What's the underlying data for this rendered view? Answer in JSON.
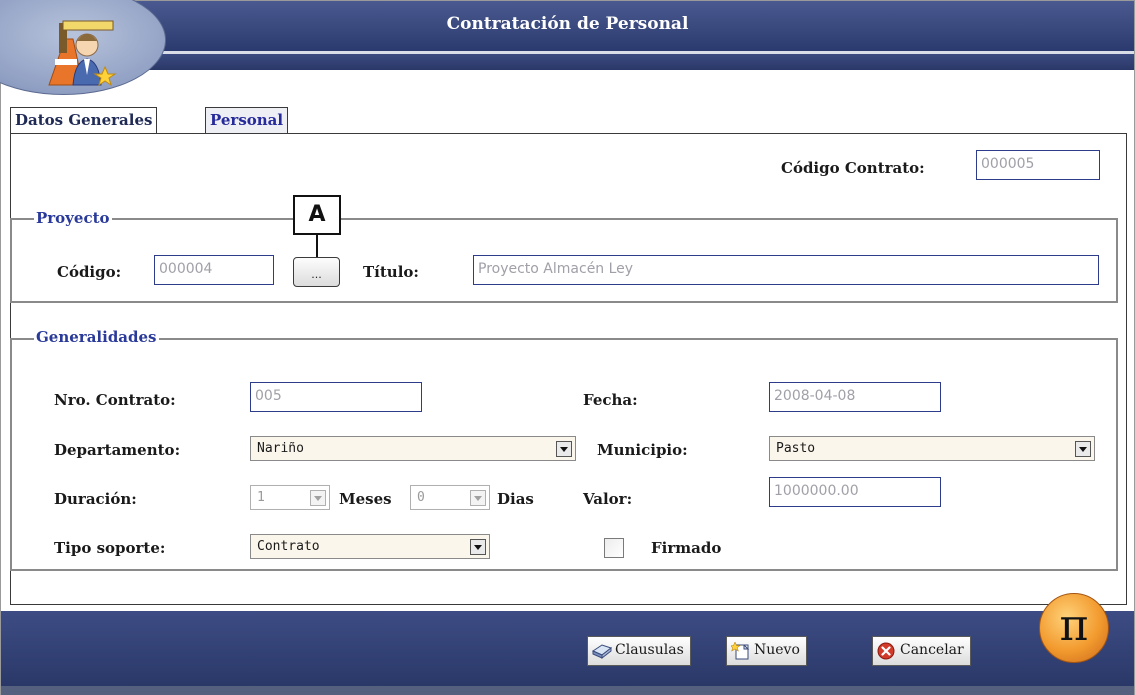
{
  "window": {
    "title": "Contratación de Personal"
  },
  "tabs": [
    {
      "label": "Datos Generales"
    },
    {
      "label": "Personal"
    }
  ],
  "codigo_contrato": {
    "label": "Código Contrato:",
    "value": "000005"
  },
  "proyecto": {
    "legend": "Proyecto",
    "codigo_label": "Código:",
    "codigo_value": "000004",
    "search_button": "...",
    "callout": "A",
    "titulo_label": "Título:",
    "titulo_value": "Proyecto Almacén Ley"
  },
  "generalidades": {
    "legend": "Generalidades",
    "nro_contrato_label": "Nro. Contrato:",
    "nro_contrato_value": "005",
    "fecha_label": "Fecha:",
    "fecha_value": "2008-04-08",
    "departamento_label": "Departamento:",
    "departamento_value": "Nariño",
    "municipio_label": "Municipio:",
    "municipio_value": "Pasto",
    "duracion_label": "Duración:",
    "duracion_meses_value": "1",
    "meses_label": "Meses",
    "duracion_dias_value": "0",
    "dias_label": "Dias",
    "valor_label": "Valor:",
    "valor_value": "1000000.00",
    "tipo_soporte_label": "Tipo soporte:",
    "tipo_soporte_value": "Contrato",
    "firmado_label": "Firmado",
    "firmado_checked": false
  },
  "footer": {
    "clausulas_label": "Clausulas",
    "nuevo_label": "Nuevo",
    "cancelar_label": "Cancelar",
    "pi_symbol": "π"
  },
  "colors": {
    "header_blue": "#2b3a6e",
    "legend_blue": "#2a3a9a",
    "input_border": "#2d3d8c",
    "pi_orange": "#f29a2e"
  }
}
